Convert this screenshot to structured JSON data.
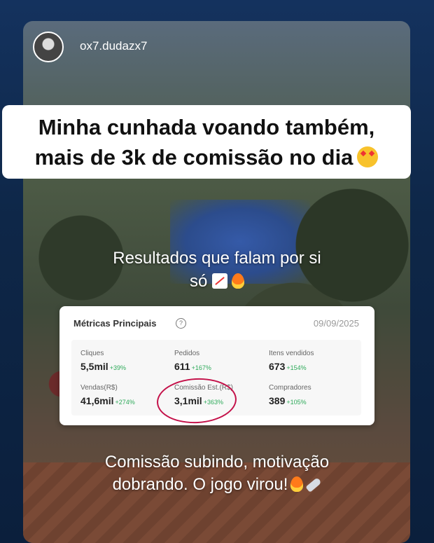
{
  "profile": {
    "username": "ox7.dudazx7"
  },
  "headline": {
    "line1": "Minha cunhada voando também,",
    "line2": "mais de 3k de comissão no dia"
  },
  "captions": {
    "top_line1": "Resultados que falam por si",
    "top_line2": "só",
    "bottom_line1": "Comissão subindo, motivação",
    "bottom_line2": "dobrando. O jogo virou!"
  },
  "metrics_card": {
    "title": "Métricas Principais",
    "date": "09/09/2025",
    "items": [
      {
        "label": "Cliques",
        "value": "5,5mil",
        "change": "+39%"
      },
      {
        "label": "Pedidos",
        "value": "611",
        "change": "+167%"
      },
      {
        "label": "Itens vendidos",
        "value": "673",
        "change": "+154%"
      },
      {
        "label": "Vendas(R$)",
        "value": "41,6mil",
        "change": "+274%"
      },
      {
        "label": "Comissão Est.(R$)",
        "value": "3,1mil",
        "change": "+363%"
      },
      {
        "label": "Compradores",
        "value": "389",
        "change": "+105%"
      }
    ]
  },
  "icons": [
    "avatar",
    "star-struck-emoji",
    "chart-increasing-emoji",
    "fire-emoji",
    "rocket-emoji",
    "info-icon"
  ],
  "colors": {
    "accent_green": "#2eaa5a",
    "highlight_circle": "#c4124a"
  }
}
